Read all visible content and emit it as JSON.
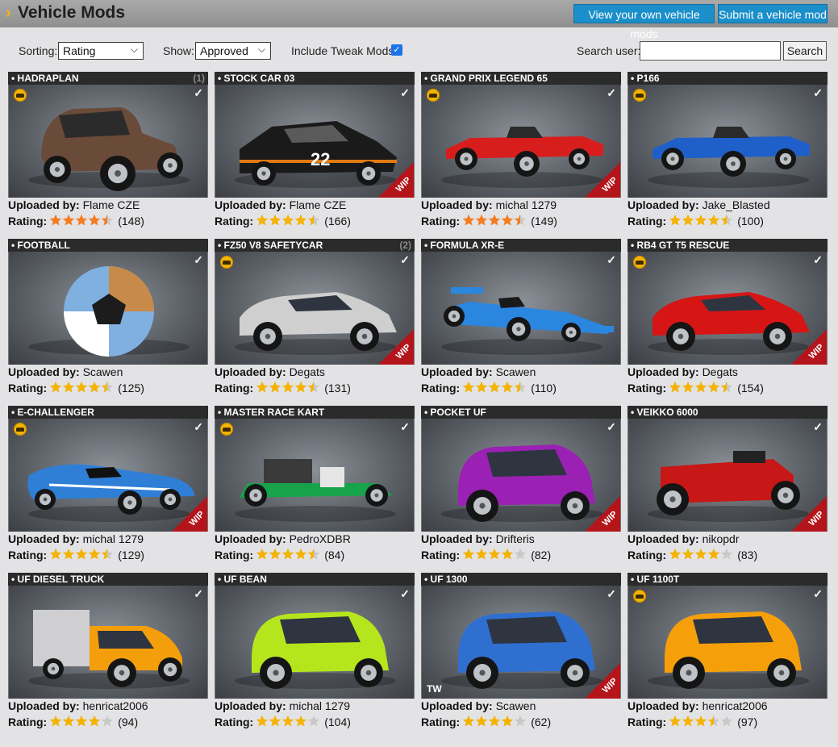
{
  "header": {
    "title": "Vehicle Mods",
    "own_mods_button": "View your own vehicle mods",
    "submit_button": "Submit a vehicle mod"
  },
  "toolbar": {
    "sorting_label": "Sorting:",
    "sorting_value": "Rating",
    "show_label": "Show:",
    "show_value": "Approved",
    "tweak_label": "Include Tweak Mods:",
    "tweak_checked": true,
    "search_label": "Search user:",
    "search_value": "",
    "search_button": "Search"
  },
  "labels": {
    "uploaded_by": "Uploaded by:",
    "rating": "Rating:",
    "wip": "WIP"
  },
  "colors": {
    "accent": "#1b8fc9",
    "star_orange": "#f57c1f",
    "star_gold": "#f5b301",
    "wip_red": "#b3151b"
  },
  "mods": [
    {
      "name": "HADRAPLAN",
      "count": "(1)",
      "uploader": "Flame CZE",
      "rating": 4.5,
      "ratings": "(148)",
      "wip": false,
      "icon": true,
      "star_color": "orange",
      "art": "ratrod",
      "body": "#6a4a38"
    },
    {
      "name": "STOCK CAR 03",
      "count": "",
      "uploader": "Flame CZE",
      "rating": 4.5,
      "ratings": "(166)",
      "wip": true,
      "icon": false,
      "star_color": "gold",
      "art": "stock",
      "body": "#1a1a1a",
      "number": "22"
    },
    {
      "name": "GRAND PRIX LEGEND 65",
      "count": "",
      "uploader": "michal 1279",
      "rating": 4.5,
      "ratings": "(149)",
      "wip": true,
      "icon": true,
      "star_color": "orange",
      "art": "formula_old",
      "body": "#d81d1d"
    },
    {
      "name": "P166",
      "count": "",
      "uploader": "Jake_Blasted",
      "rating": 4.5,
      "ratings": "(100)",
      "wip": false,
      "icon": true,
      "star_color": "gold",
      "art": "formula_old",
      "body": "#1e5fc9"
    },
    {
      "name": "FOOTBALL",
      "count": "",
      "uploader": "Scawen",
      "rating": 4.5,
      "ratings": "(125)",
      "wip": false,
      "icon": false,
      "star_color": "gold",
      "art": "ball",
      "body": "#7fb0e0"
    },
    {
      "name": "FZ50 V8 SAFETYCAR",
      "count": "(2)",
      "uploader": "Degats",
      "rating": 4.5,
      "ratings": "(131)",
      "wip": true,
      "icon": true,
      "star_color": "gold",
      "art": "sportscar",
      "body": "#cfcfcf"
    },
    {
      "name": "FORMULA XR-E",
      "count": "",
      "uploader": "Scawen",
      "rating": 4.5,
      "ratings": "(110)",
      "wip": false,
      "icon": false,
      "star_color": "gold",
      "art": "formula_new",
      "body": "#2b86e0"
    },
    {
      "name": "RB4 GT T5 RESCUE",
      "count": "",
      "uploader": "Degats",
      "rating": 4.5,
      "ratings": "(154)",
      "wip": true,
      "icon": true,
      "star_color": "gold",
      "art": "sportscar",
      "body": "#d61515"
    },
    {
      "name": "E-CHALLENGER",
      "count": "",
      "uploader": "michal 1279",
      "rating": 4.5,
      "ratings": "(129)",
      "wip": true,
      "icon": true,
      "star_color": "gold",
      "art": "proto",
      "body": "#2f7fd6"
    },
    {
      "name": "MASTER RACE KART",
      "count": "",
      "uploader": "PedroXDBR",
      "rating": 4.5,
      "ratings": "(84)",
      "wip": false,
      "icon": true,
      "star_color": "gold",
      "art": "kart",
      "body": "#17a34a"
    },
    {
      "name": "POCKET UF",
      "count": "",
      "uploader": "Drifteris",
      "rating": 4.0,
      "ratings": "(82)",
      "wip": true,
      "icon": false,
      "star_color": "gold",
      "art": "mini",
      "body": "#9a21b3"
    },
    {
      "name": "VEIKKO 6000",
      "count": "",
      "uploader": "nikopdr",
      "rating": 4.0,
      "ratings": "(83)",
      "wip": true,
      "icon": false,
      "star_color": "gold",
      "art": "mower",
      "body": "#c81717"
    },
    {
      "name": "UF DIESEL TRUCK",
      "count": "",
      "uploader": "henricat2006",
      "rating": 4.0,
      "ratings": "(94)",
      "wip": false,
      "icon": false,
      "star_color": "gold",
      "art": "truck",
      "body": "#f59e0b"
    },
    {
      "name": "UF BEAN",
      "count": "",
      "uploader": "michal 1279",
      "rating": 4.0,
      "ratings": "(104)",
      "wip": false,
      "icon": false,
      "star_color": "gold",
      "art": "mini",
      "body": "#b5e61d"
    },
    {
      "name": "UF 1300",
      "count": "",
      "uploader": "Scawen",
      "rating": 4.0,
      "ratings": "(62)",
      "wip": true,
      "icon": false,
      "star_color": "gold",
      "art": "mini",
      "body": "#2f6fd0",
      "tag": "TW"
    },
    {
      "name": "UF 1100T",
      "count": "",
      "uploader": "henricat2006",
      "rating": 3.5,
      "ratings": "(97)",
      "wip": false,
      "icon": true,
      "star_color": "gold",
      "art": "mini",
      "body": "#f5a00b"
    }
  ]
}
